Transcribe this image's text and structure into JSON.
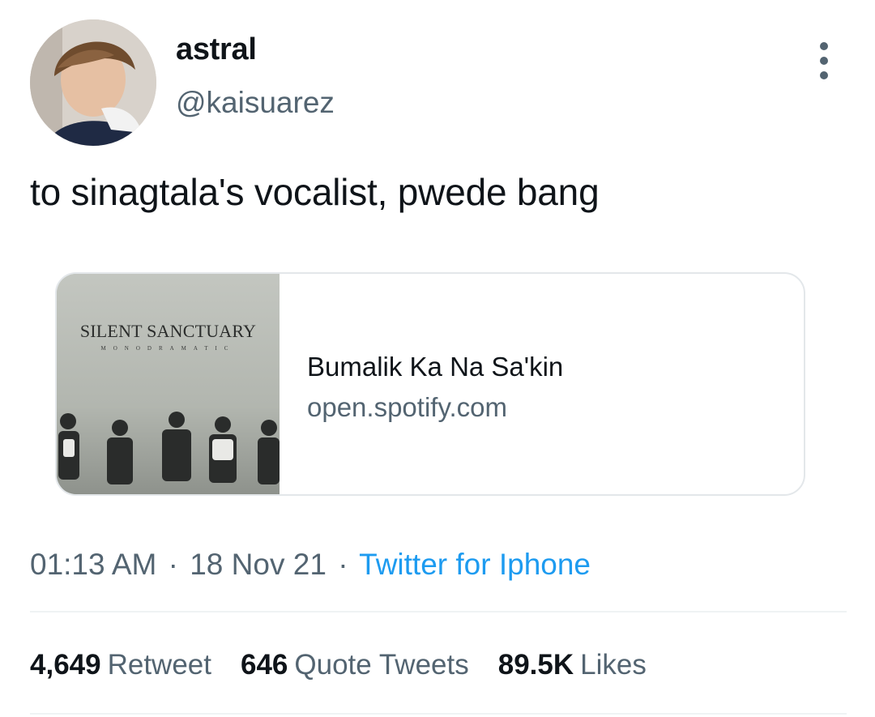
{
  "author": {
    "display_name": "astral",
    "handle": "@kaisuarez"
  },
  "icons": {
    "more": "more-vertical-icon"
  },
  "tweet": {
    "text": "to sinagtala's vocalist, pwede bang"
  },
  "card": {
    "thumbnail_band": "SILENT SANCTUARY",
    "thumbnail_album": "MONODRAMATIC",
    "title": "Bumalik Ka Na Sa'kin",
    "domain": "open.spotify.com"
  },
  "meta": {
    "time": "01:13 AM",
    "date": "18 Nov 21",
    "source": "Twitter for Iphone",
    "separator": "·"
  },
  "stats": {
    "retweets": {
      "count": "4,649",
      "label": "Retweet"
    },
    "quotes": {
      "count": "646",
      "label": "Quote Tweets"
    },
    "likes": {
      "count": "89.5K",
      "label": "Likes"
    }
  },
  "colors": {
    "text_primary": "#0f1419",
    "text_secondary": "#536471",
    "link": "#1d9bf0",
    "border": "#e3e7ea"
  }
}
